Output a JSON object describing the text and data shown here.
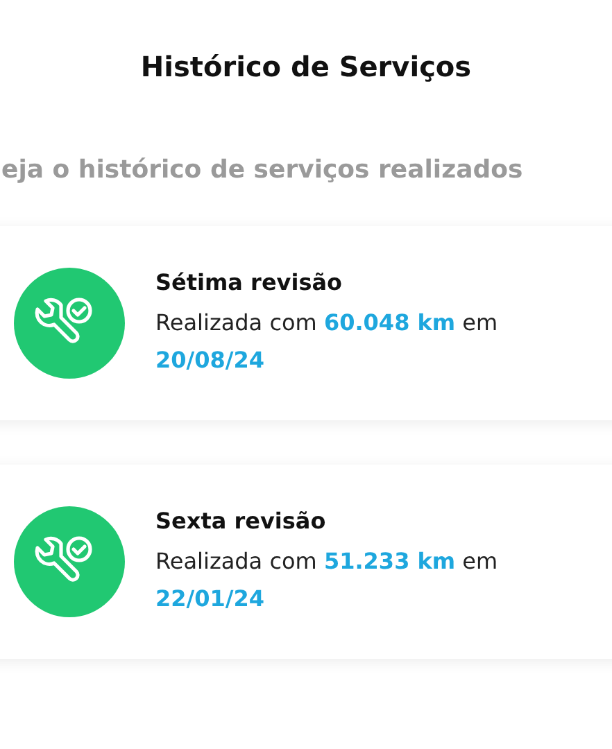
{
  "header": {
    "title": "Histórico de Serviços"
  },
  "subtitle": "eja o histórico de serviços realizados",
  "services": [
    {
      "title": "Sétima revisão",
      "description": "Realizada com **60.048 km** em **20/08/24**"
    },
    {
      "title": "Sexta revisão",
      "description": "Realizada com **51.233 km** em **22/01/24**"
    }
  ]
}
